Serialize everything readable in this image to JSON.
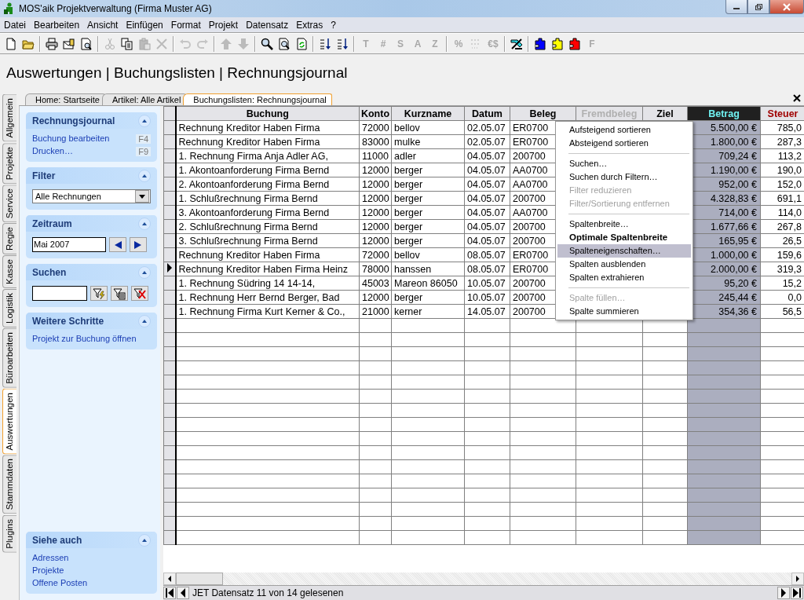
{
  "window": {
    "title": "MOS'aik Projektverwaltung (Firma Muster AG)"
  },
  "menu_bar": [
    "Datei",
    "Bearbeiten",
    "Ansicht",
    "Einfügen",
    "Format",
    "Projekt",
    "Datensatz",
    "Extras",
    "?"
  ],
  "toolbar": [
    {
      "kind": "new",
      "disabled": false
    },
    {
      "kind": "open",
      "disabled": false
    },
    {
      "kind": "separator"
    },
    {
      "kind": "print",
      "disabled": false
    },
    {
      "kind": "mail",
      "disabled": false
    },
    {
      "kind": "preview",
      "disabled": false
    },
    {
      "kind": "separator"
    },
    {
      "kind": "cut",
      "disabled": true
    },
    {
      "kind": "copy",
      "disabled": false
    },
    {
      "kind": "paste",
      "disabled": true
    },
    {
      "kind": "delete",
      "disabled": true
    },
    {
      "kind": "separator"
    },
    {
      "kind": "undo",
      "disabled": true
    },
    {
      "kind": "redo",
      "disabled": true
    },
    {
      "kind": "separator"
    },
    {
      "kind": "up",
      "disabled": true
    },
    {
      "kind": "down",
      "disabled": true
    },
    {
      "kind": "separator"
    },
    {
      "kind": "search",
      "disabled": false
    },
    {
      "kind": "find-doc",
      "disabled": false
    },
    {
      "kind": "refresh",
      "disabled": false
    },
    {
      "kind": "separator"
    },
    {
      "kind": "sort-asc",
      "disabled": false
    },
    {
      "kind": "sort-desc",
      "disabled": false
    },
    {
      "kind": "separator"
    },
    {
      "kind": "glyph",
      "text": "T",
      "disabled": true
    },
    {
      "kind": "glyph",
      "text": "#",
      "disabled": true
    },
    {
      "kind": "glyph",
      "text": "S",
      "disabled": true
    },
    {
      "kind": "glyph",
      "text": "A",
      "disabled": true
    },
    {
      "kind": "glyph",
      "text": "Z",
      "disabled": true
    },
    {
      "kind": "separator"
    },
    {
      "kind": "glyph",
      "text": "%",
      "disabled": true
    },
    {
      "kind": "numbering",
      "disabled": true
    },
    {
      "kind": "glyph",
      "text": "€$",
      "disabled": true
    },
    {
      "kind": "separator"
    },
    {
      "kind": "tools",
      "disabled": false
    },
    {
      "kind": "separator"
    },
    {
      "kind": "plugin",
      "color": "#0000ff",
      "disabled": false
    },
    {
      "kind": "plugin",
      "color": "#ffff00",
      "disabled": false
    },
    {
      "kind": "plugin",
      "color": "#ff0000",
      "disabled": false
    },
    {
      "kind": "glyph",
      "text": "F",
      "disabled": true
    }
  ],
  "breadcrumb": "Auswertungen | Buchungslisten | Rechnungsjournal",
  "side_tabs": [
    {
      "label": "Allgemein",
      "selected": false
    },
    {
      "label": "Projekte",
      "selected": false
    },
    {
      "label": "Service",
      "selected": false
    },
    {
      "label": "Regie",
      "selected": false
    },
    {
      "label": "Kasse",
      "selected": false
    },
    {
      "label": "Logistik",
      "selected": false
    },
    {
      "label": "Büroarbeiten",
      "selected": false
    },
    {
      "label": "Auswertungen",
      "selected": true
    },
    {
      "label": "Stammdaten",
      "selected": false
    },
    {
      "label": "Plugins",
      "selected": false
    }
  ],
  "document_tabs": [
    {
      "label": "Home: Startseite",
      "selected": false
    },
    {
      "label": "Artikel: Alle Artikel",
      "selected": false
    },
    {
      "label": "Buchungslisten: Rechnungsjournal",
      "selected": true
    }
  ],
  "task_panels": [
    {
      "kind": "links",
      "title": "Rechnungsjournal",
      "items": [
        {
          "label": "Buchung bearbeiten",
          "shortcut": "F4"
        },
        {
          "label": "Drucken…",
          "shortcut": "F9"
        }
      ]
    },
    {
      "kind": "select",
      "title": "Filter",
      "value": "Alle Rechnungen"
    },
    {
      "kind": "period",
      "title": "Zeitraum",
      "value": "Mai 2007"
    },
    {
      "kind": "search",
      "title": "Suchen"
    },
    {
      "kind": "links",
      "title": "Weitere Schritte",
      "items": [
        {
          "label": "Projekt zur Buchung öffnen"
        }
      ]
    },
    {
      "kind": "links",
      "title": "Siehe auch",
      "items": [
        {
          "label": "Adressen"
        },
        {
          "label": "Projekte"
        },
        {
          "label": "Offene Posten"
        }
      ]
    }
  ],
  "grid": {
    "columns": [
      {
        "label": "Buchung",
        "selected": false,
        "disabled": false,
        "accent": false
      },
      {
        "label": "Konto",
        "selected": false,
        "disabled": false,
        "accent": false
      },
      {
        "label": "Kurzname",
        "selected": false,
        "disabled": false,
        "accent": false
      },
      {
        "label": "Datum",
        "selected": false,
        "disabled": false,
        "accent": false
      },
      {
        "label": "Beleg",
        "selected": false,
        "disabled": false,
        "accent": false
      },
      {
        "label": "Fremdbeleg",
        "selected": false,
        "disabled": true,
        "accent": false
      },
      {
        "label": "Ziel",
        "selected": false,
        "disabled": false,
        "accent": false
      },
      {
        "label": "Betrag",
        "selected": true,
        "disabled": false,
        "accent": false
      },
      {
        "label": "Steuer",
        "selected": false,
        "disabled": false,
        "accent": true
      }
    ],
    "rows": [
      {
        "current": false,
        "cells": [
          "Rechnung Kreditor Haben Firma",
          "72000",
          "bellov",
          "02.05.07",
          "ER0700",
          "",
          "",
          "5.500,00 €",
          "785,0"
        ]
      },
      {
        "current": false,
        "cells": [
          "Rechnung Kreditor Haben Firma",
          "83000",
          "mulke",
          "02.05.07",
          "ER0700",
          "",
          "",
          "1.800,00 €",
          "287,3"
        ]
      },
      {
        "current": false,
        "cells": [
          "1. Rechnung Firma Anja Adler AG,",
          "11000",
          "adler",
          "04.05.07",
          "200700",
          "",
          "",
          "709,24 €",
          "113,2"
        ]
      },
      {
        "current": false,
        "cells": [
          "1. Akontoanforderung Firma Bernd",
          "12000",
          "berger",
          "04.05.07",
          "AA0700",
          "",
          "",
          "1.190,00 €",
          "190,0"
        ]
      },
      {
        "current": false,
        "cells": [
          "2. Akontoanforderung Firma Bernd",
          "12000",
          "berger",
          "04.05.07",
          "AA0700",
          "",
          "",
          "952,00 €",
          "152,0"
        ]
      },
      {
        "current": false,
        "cells": [
          "1. Schlußrechnung Firma Bernd",
          "12000",
          "berger",
          "04.05.07",
          "200700",
          "",
          "",
          "4.328,83 €",
          "691,1"
        ]
      },
      {
        "current": false,
        "cells": [
          "3. Akontoanforderung Firma Bernd",
          "12000",
          "berger",
          "04.05.07",
          "AA0700",
          "",
          "",
          "714,00 €",
          "114,0"
        ]
      },
      {
        "current": false,
        "cells": [
          "2. Schlußrechnung Firma Bernd",
          "12000",
          "berger",
          "04.05.07",
          "200700",
          "",
          "",
          "1.677,66 €",
          "267,8"
        ]
      },
      {
        "current": false,
        "cells": [
          "3. Schlußrechnung Firma Bernd",
          "12000",
          "berger",
          "04.05.07",
          "200700",
          "",
          "",
          "165,95 €",
          "26,5"
        ]
      },
      {
        "current": false,
        "cells": [
          "Rechnung Kreditor Haben Firma",
          "72000",
          "bellov",
          "08.05.07",
          "ER0700",
          "",
          "",
          "1.000,00 €",
          "159,6"
        ]
      },
      {
        "current": true,
        "cells": [
          "Rechnung Kreditor Haben Firma Heinz",
          "78000",
          "hanssen",
          "08.05.07",
          "ER0700",
          "",
          "",
          "2.000,00 €",
          "319,3"
        ]
      },
      {
        "current": false,
        "cells": [
          "1. Rechnung Südring 14 14-14,",
          "45003",
          "Mareon 86050",
          "10.05.07",
          "200700",
          "",
          "",
          "95,20 €",
          "15,2"
        ]
      },
      {
        "current": false,
        "cells": [
          "1. Rechnung Herr Bernd Berger, Bad",
          "12000",
          "berger",
          "10.05.07",
          "200700",
          "",
          "",
          "245,44 €",
          "0,0"
        ]
      },
      {
        "current": false,
        "cells": [
          "1. Rechnung Firma Kurt Kerner & Co.,",
          "21000",
          "kerner",
          "14.05.07",
          "200700",
          "",
          "",
          "354,36 €",
          "56,5"
        ]
      }
    ]
  },
  "context_menu": [
    {
      "kind": "item",
      "label": "Aufsteigend sortieren",
      "disabled": false,
      "bold": false,
      "selected": false
    },
    {
      "kind": "item",
      "label": "Absteigend sortieren",
      "disabled": false,
      "bold": false,
      "selected": false
    },
    {
      "kind": "separator"
    },
    {
      "kind": "item",
      "label": "Suchen…",
      "disabled": false,
      "bold": false,
      "selected": false
    },
    {
      "kind": "item",
      "label": "Suchen durch Filtern…",
      "disabled": false,
      "bold": false,
      "selected": false
    },
    {
      "kind": "item",
      "label": "Filter reduzieren",
      "disabled": true,
      "bold": false,
      "selected": false
    },
    {
      "kind": "item",
      "label": "Filter/Sortierung entfernen",
      "disabled": true,
      "bold": false,
      "selected": false
    },
    {
      "kind": "separator"
    },
    {
      "kind": "item",
      "label": "Spaltenbreite…",
      "disabled": false,
      "bold": false,
      "selected": false
    },
    {
      "kind": "item",
      "label": "Optimale Spaltenbreite",
      "disabled": false,
      "bold": true,
      "selected": false
    },
    {
      "kind": "item",
      "label": "Spalteneigenschaften…",
      "disabled": false,
      "bold": false,
      "selected": true
    },
    {
      "kind": "item",
      "label": "Spalten ausblenden",
      "disabled": false,
      "bold": false,
      "selected": false
    },
    {
      "kind": "item",
      "label": "Spalten extrahieren",
      "disabled": false,
      "bold": false,
      "selected": false
    },
    {
      "kind": "separator"
    },
    {
      "kind": "item",
      "label": "Spalte füllen…",
      "disabled": true,
      "bold": false,
      "selected": false
    },
    {
      "kind": "item",
      "label": "Spalte summieren",
      "disabled": false,
      "bold": false,
      "selected": false
    }
  ],
  "status": "JET Datensatz 11 von 14 gelesenen"
}
